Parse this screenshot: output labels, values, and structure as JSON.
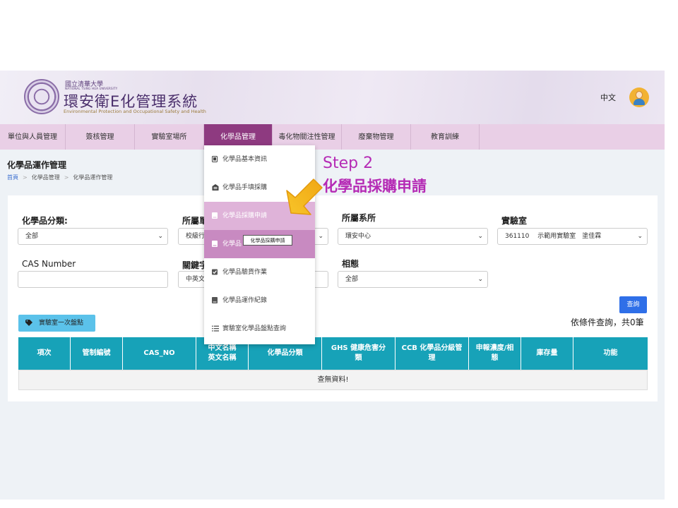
{
  "header": {
    "univ_name": "國立清華大學",
    "univ_name_en": "NATIONAL TSING HUA UNIVERSITY",
    "app_title": "環安衛E化管理系統",
    "app_subtitle": "Environmental Protection and Occupational Safety and Health",
    "language": "中文"
  },
  "nav": {
    "items": [
      {
        "label": "單位與人員管理"
      },
      {
        "label": "簽核管理"
      },
      {
        "label": "實驗室場所"
      },
      {
        "label": "化學品管理"
      },
      {
        "label": "毒化物關注性管理"
      },
      {
        "label": "廢棄物管理"
      },
      {
        "label": "教育訓練"
      }
    ],
    "active": "化學品管理"
  },
  "page": {
    "title": "化學品運作管理",
    "breadcrumb": [
      "首頁",
      "化學品管理",
      "化學品運作管理"
    ]
  },
  "filters": {
    "category_label": "化學品分類:",
    "category_value": "全部",
    "affiliation_label": "所屬單",
    "affiliation_value": "校級行",
    "department_label": "所屬系所",
    "department_value": "環安中心",
    "lab_label": "實驗室",
    "lab_value": "361110　 示範用實驗室　塗佳霖",
    "cas_label": "CAS Number",
    "cas_value": "",
    "keyword_label": "關鍵字",
    "keyword_value": "中英文",
    "phase_label": "相態",
    "phase_value": "全部"
  },
  "actions": {
    "query": "查詢",
    "lab_stocktake": "實驗室一次盤點",
    "result_count": "依條件查詢，共0筆"
  },
  "table": {
    "columns": [
      "項次",
      "管制編號",
      "CAS_NO",
      "中文名稱\n英文名稱",
      "化學品分類",
      "GHS 健康危害分類",
      "CCB 化學品分級管理",
      "申報濃度/相態",
      "庫存量",
      "功能"
    ],
    "empty_message": "查無資料!"
  },
  "dropdown": {
    "items": [
      {
        "label": "化學品基本資訊",
        "icon": "tablet-icon"
      },
      {
        "label": "化學品手填採購",
        "icon": "warehouse-icon"
      },
      {
        "label": "化學品採購申請",
        "icon": "book-icon"
      },
      {
        "label": "化學品",
        "icon": "book-icon"
      },
      {
        "label": "化學品驗貨作業",
        "icon": "checkbox-icon"
      },
      {
        "label": "化學品運作紀錄",
        "icon": "book-icon"
      },
      {
        "label": "實驗室化學品盤點查詢",
        "icon": "list-icon"
      }
    ],
    "tooltip": "化學品採購申請"
  },
  "annotation": {
    "step": "Step 2",
    "description": "化學品採購申請"
  },
  "colors": {
    "nav_bg": "#e9cfe6",
    "nav_active": "#8e3a80",
    "table_header": "#17a2b8",
    "query_button": "#2f6fe8",
    "stock_button": "#5bc2ea",
    "annotation": "#b52bb5",
    "arrow": "#f2b91c"
  }
}
